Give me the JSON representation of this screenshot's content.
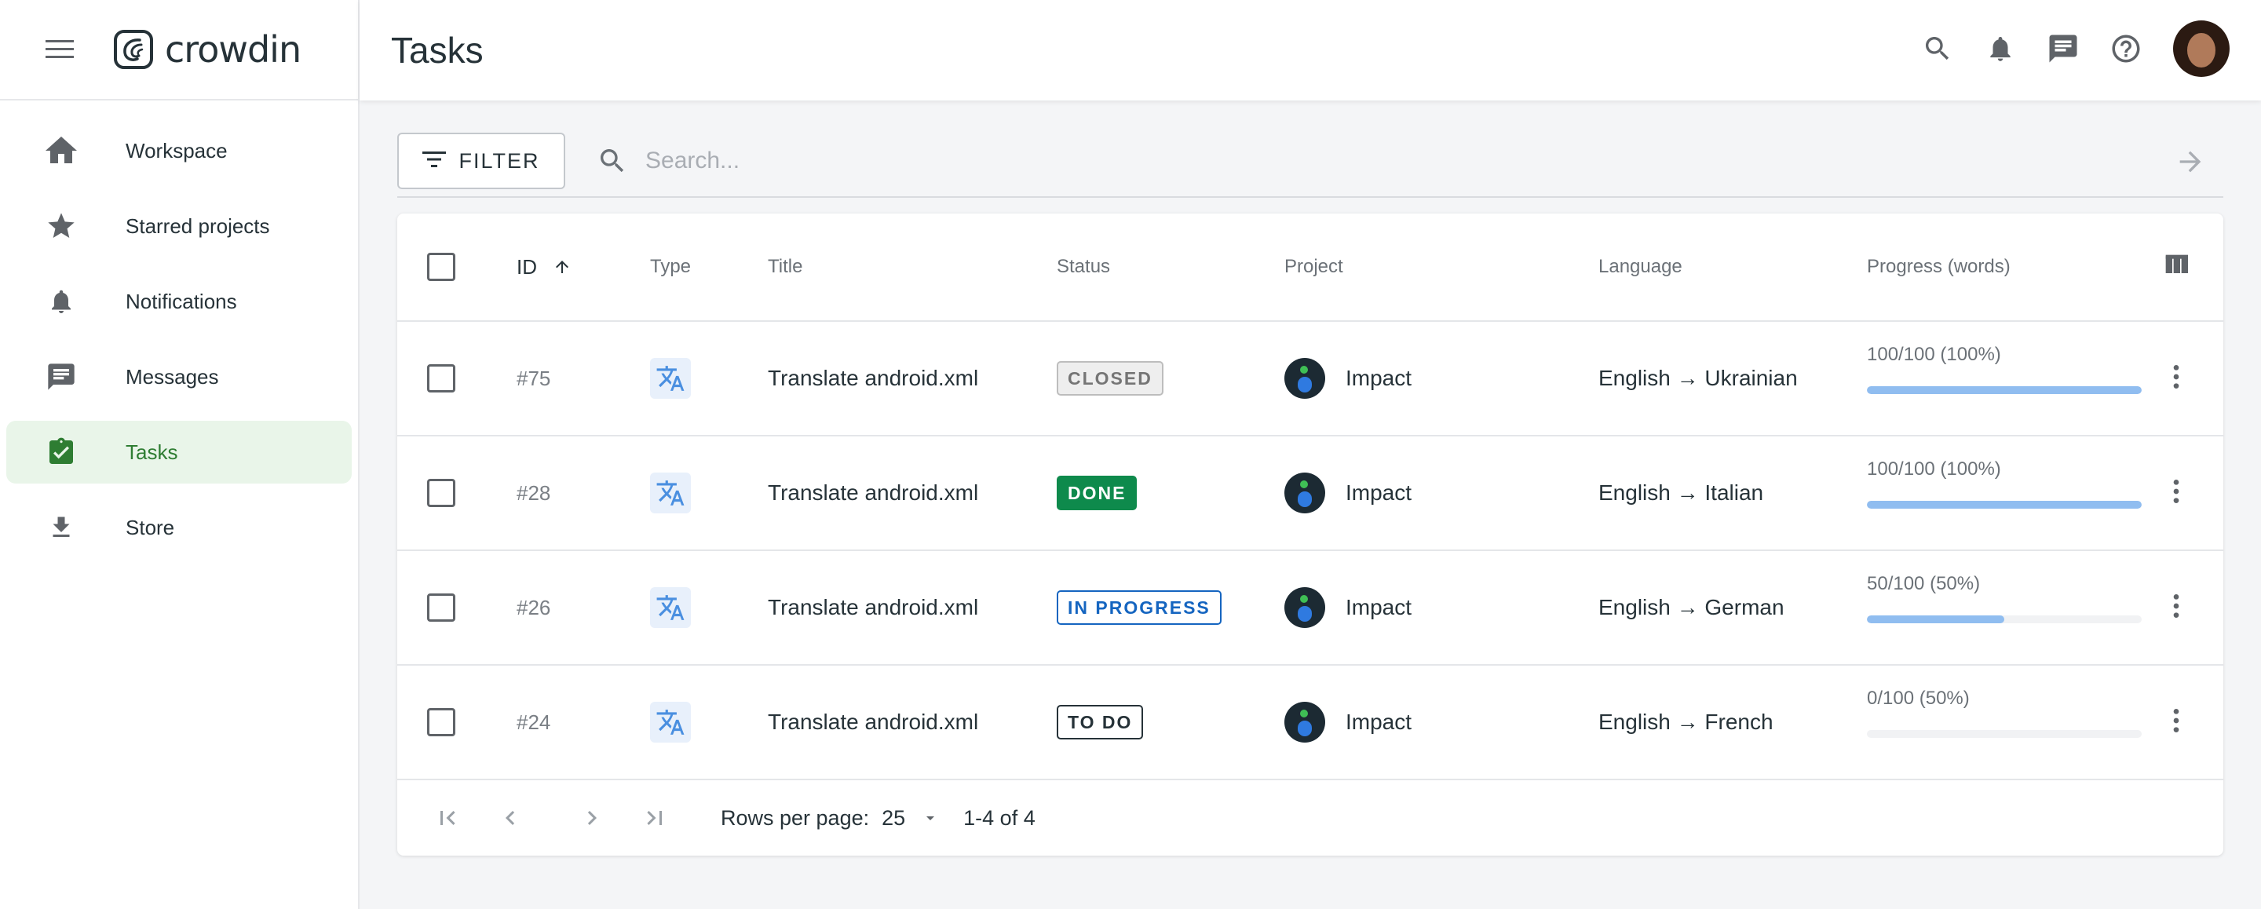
{
  "app": {
    "brand": "crowdin",
    "accent": "#2e7d32"
  },
  "sidebar": {
    "items": [
      {
        "label": "Workspace",
        "icon": "home-icon"
      },
      {
        "label": "Starred projects",
        "icon": "star-icon"
      },
      {
        "label": "Notifications",
        "icon": "bell-icon"
      },
      {
        "label": "Messages",
        "icon": "message-icon"
      },
      {
        "label": "Tasks",
        "icon": "clipboard-check-icon",
        "active": true
      },
      {
        "label": "Store",
        "icon": "download-icon"
      }
    ]
  },
  "header": {
    "title": "Tasks"
  },
  "toolbar": {
    "filter_label": "FILTER",
    "search_placeholder": "Search..."
  },
  "table": {
    "columns": {
      "id": "ID",
      "type": "Type",
      "title": "Title",
      "status": "Status",
      "project": "Project",
      "language": "Language",
      "progress": "Progress (words)"
    },
    "rows": [
      {
        "id": "#75",
        "title": "Translate android.xml",
        "status": "CLOSED",
        "status_kind": "closed",
        "project": "Impact",
        "language": "English → Ukrainian",
        "progress_text": "100/100 (100%)",
        "progress": 1.0
      },
      {
        "id": "#28",
        "title": "Translate android.xml",
        "status": "DONE",
        "status_kind": "done",
        "project": "Impact",
        "language": "English → Italian",
        "progress_text": "100/100 (100%)",
        "progress": 1.0
      },
      {
        "id": "#26",
        "title": "Translate android.xml",
        "status": "IN PROGRESS",
        "status_kind": "inprogress",
        "project": "Impact",
        "language": "English → German",
        "progress_text": "50/100 (50%)",
        "progress": 0.5
      },
      {
        "id": "#24",
        "title": "Translate android.xml",
        "status": "TO DO",
        "status_kind": "todo",
        "project": "Impact",
        "language": "English → French",
        "progress_text": "0/100 (50%)",
        "progress": 0.0
      }
    ]
  },
  "pagination": {
    "rows_per_page_label": "Rows per page:",
    "rows_per_page": "25",
    "range": "1-4 of 4"
  }
}
